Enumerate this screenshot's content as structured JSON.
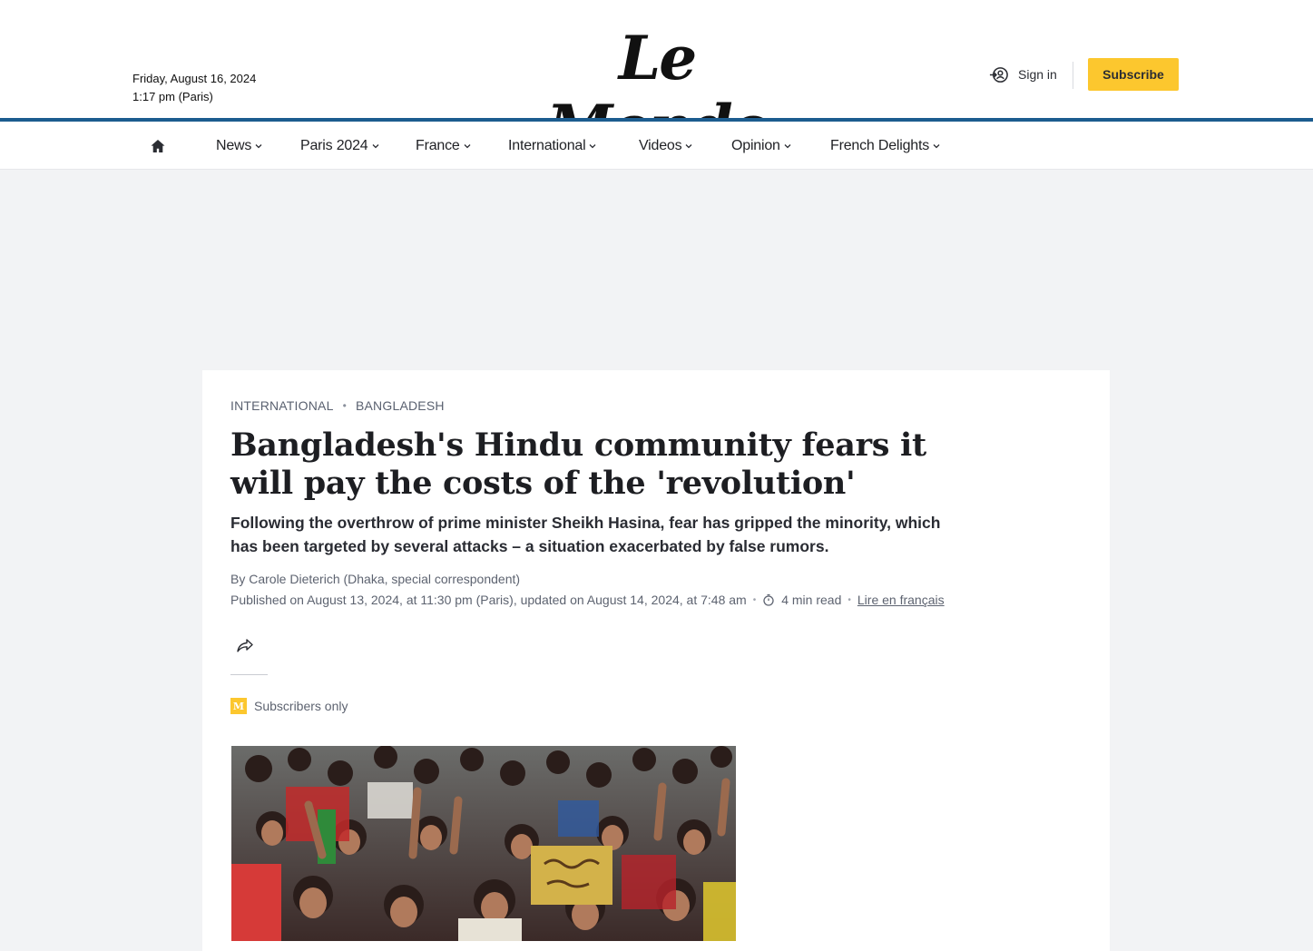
{
  "header": {
    "date": "Friday, August 16, 2024",
    "time": "1:17 pm (Paris)",
    "logo": "Le Monde",
    "signin_label": "Sign in",
    "subscribe_label": "Subscribe"
  },
  "nav": {
    "items": [
      {
        "label": "News"
      },
      {
        "label": "Paris 2024"
      },
      {
        "label": "France"
      },
      {
        "label": "International"
      },
      {
        "label": "Videos"
      },
      {
        "label": "Opinion"
      },
      {
        "label": "French Delights"
      }
    ]
  },
  "article": {
    "section": "International",
    "subsection": "Bangladesh",
    "title": "Bangladesh's Hindu community fears it will pay the costs of the 'revolution'",
    "standfirst": "Following the overthrow of prime minister Sheikh Hasina, fear has gripped the minority, which has been targeted by several attacks – a situation exacerbated by false rumors.",
    "byline": "By Carole Dieterich (Dhaka, special correspondent)",
    "published": "Published on August 13, 2024, at 11:30 pm (Paris), updated on August 14, 2024, at 7:48 am",
    "read_time": "4 min read",
    "french_link": "Lire en français",
    "subscribers_only": "Subscribers only",
    "badge_letter": "M"
  },
  "colors": {
    "accent_blue": "#1c5c8f",
    "subscribe_yellow": "#fcc72e"
  }
}
